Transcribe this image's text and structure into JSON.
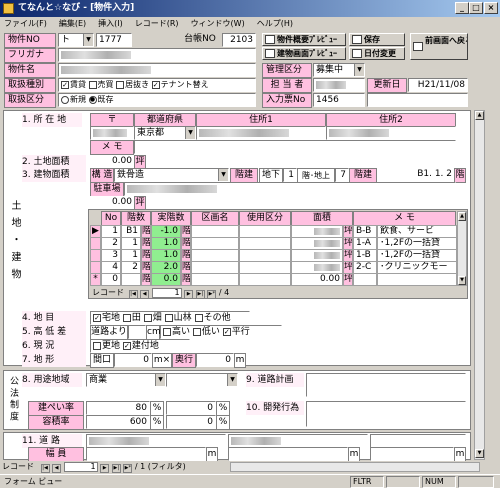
{
  "window": {
    "title": "てなんと☆なび - [物件入力]"
  },
  "menu": [
    "ファイル(F)",
    "編集(E)",
    "挿入(I)",
    "レコード(R)",
    "ウィンドウ(W)",
    "ヘルプ(H)"
  ],
  "header": {
    "bukken_no_label": "物件NO",
    "bukken_no_prefix": "ト",
    "bukken_no_value": "1777",
    "daicho_label": "台帳NO",
    "daicho_value": "2103",
    "furigana_label": "フリガナ",
    "bukken_name_label": "物件名",
    "torihiki_label": "取扱種別",
    "torihiki_options": [
      "賃貸",
      "売買",
      "居抜き",
      "テナント替え"
    ],
    "torihiki_checked": [
      true,
      false,
      false,
      true
    ],
    "kubun_label": "取扱区分",
    "kubun_options": [
      "新規",
      "既存"
    ],
    "kanri_label": "管理区分",
    "kanri_value": "募集中",
    "tanto_label": "担 当 者",
    "koshin_label": "更新日",
    "koshin_value": "H21/11/08",
    "nyuryoku_label": "入力票No",
    "nyuryoku_value": "1456"
  },
  "buttons": {
    "overview": "物件概要ﾌﾟﾚﾋﾞｭｰ",
    "building": "建物画面ﾌﾟﾚﾋﾞｭｰ",
    "save": "保存",
    "date_change": "日付変更",
    "prev": "前画面へ戻る"
  },
  "land_label": "土 地 ・ 建 物",
  "s1": {
    "label": "1. 所 在 地",
    "yubin": "〒",
    "todofuken_h": "都道府県",
    "jusho1_h": "住所1",
    "jusho2_h": "住所2",
    "todofuken": "東京都",
    "memo": "メ モ"
  },
  "s2": {
    "label": "2. 土地面積",
    "value": "0.00",
    "unit": "坪"
  },
  "s3": {
    "label": "3. 建物面積",
    "kozo_label": "構 造",
    "kozo": "鉄骨造",
    "kaidate": "階建",
    "chika": "地下",
    "chika_v": "1",
    "chijo_label": "階･地上",
    "chijo_v": "7",
    "kaidate2": "階建",
    "floors": "B1. 1. 2",
    "kai": "階",
    "parking": "駐車場",
    "area": "0.00",
    "unit": "坪"
  },
  "floor_table": {
    "headers": [
      "No",
      "階数",
      "実階数",
      "区画名",
      "使用区分",
      "面積",
      "メ モ"
    ],
    "rows": [
      {
        "no": "1",
        "kai": "B1",
        "jitsu": "-1.0",
        "kukaku": "",
        "shiyo": "",
        "menseki": "",
        "unit": "坪",
        "code": "B-B",
        "memo": "飲食、サービ"
      },
      {
        "no": "2",
        "kai": "1",
        "jitsu": "1.0",
        "kukaku": "",
        "shiyo": "",
        "menseki": "",
        "unit": "坪",
        "code": "1-A",
        "memo": "･1,2Fの一括貸"
      },
      {
        "no": "3",
        "kai": "1",
        "jitsu": "1.0",
        "kukaku": "",
        "shiyo": "",
        "menseki": "",
        "unit": "坪",
        "code": "1-B",
        "memo": "･1,2Fの一括貸"
      },
      {
        "no": "4",
        "kai": "2",
        "jitsu": "2.0",
        "kukaku": "",
        "shiyo": "",
        "menseki": "",
        "unit": "坪",
        "code": "2-C",
        "memo": "･クリニックモー"
      },
      {
        "no": "0",
        "kai": "",
        "jitsu": "0.0",
        "kukaku": "",
        "shiyo": "",
        "menseki": "0.00",
        "unit": "坪",
        "code": "",
        "memo": ""
      }
    ],
    "record_label": "レコード",
    "record_current": "1",
    "record_total": "/ 4"
  },
  "s4": {
    "label": "4. 地 目",
    "options": [
      "宅地",
      "田",
      "畑",
      "山林",
      "その他"
    ],
    "checked": [
      true,
      false,
      false,
      false,
      false
    ]
  },
  "s5": {
    "label": "5. 高 低 差",
    "road": "道路より",
    "unit": "cm",
    "options": [
      "高い",
      "低い",
      "平行"
    ],
    "checked": [
      false,
      false,
      true
    ]
  },
  "s6": {
    "label": "6. 現 況",
    "options": [
      "更地",
      "建付地"
    ],
    "checked": [
      false,
      true
    ]
  },
  "s7": {
    "label": "7. 地 形",
    "maguchi": "間口",
    "m1": "0",
    "mx": "m×",
    "okuyuki": "奥行",
    "m2": "0",
    "m": "m"
  },
  "public_label": "公 法 制 度",
  "s8": {
    "label": "8. 用途地域",
    "value": "商業",
    "kenpei": "建ぺい率",
    "kenpei_v": "80",
    "yoseki": "容積率",
    "yoseki_v": "600",
    "pct": "%",
    "val0": "0"
  },
  "s9": {
    "label": "9. 道路計画"
  },
  "s10": {
    "label": "10. 開発行為"
  },
  "s11": {
    "label": "11. 道 路",
    "fukuin": "幅 員",
    "m": "m"
  },
  "bottom_record": {
    "label": "レコード",
    "current": "1",
    "total": "/ 1 (フィルタ)"
  },
  "status": {
    "form_view": "フォーム ビュー",
    "fltr": "FLTR",
    "num": "NUM"
  }
}
